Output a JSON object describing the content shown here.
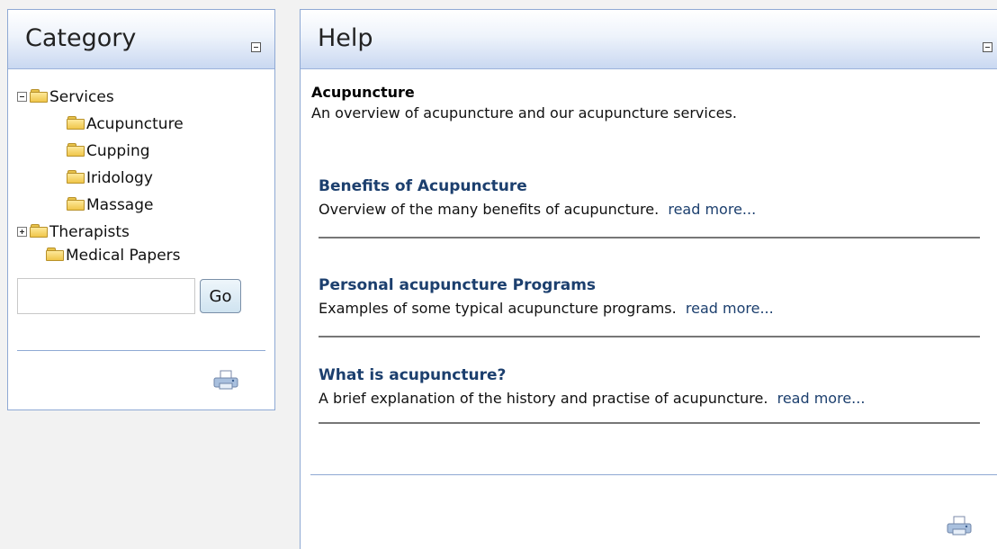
{
  "category": {
    "title": "Category",
    "tree": [
      {
        "label": "Services",
        "expander": "minus",
        "level": 0
      },
      {
        "label": "Acupuncture",
        "expander": "none",
        "level": 1
      },
      {
        "label": "Cupping",
        "expander": "none",
        "level": 1
      },
      {
        "label": "Iridology",
        "expander": "none",
        "level": 1
      },
      {
        "label": "Massage",
        "expander": "none",
        "level": 1
      },
      {
        "label": "Therapists",
        "expander": "plus",
        "level": 0
      },
      {
        "label": "Medical Papers",
        "expander": "none",
        "level": 0
      }
    ],
    "search": {
      "value": "",
      "placeholder": ""
    },
    "go_label": "Go",
    "icons": {
      "collapse": "collapse-icon",
      "folder": "folder-icon",
      "print": "print-icon"
    }
  },
  "help": {
    "title": "Help",
    "intro": {
      "title": "Acupuncture",
      "description": "An overview of acupuncture and our acupuncture services."
    },
    "articles": [
      {
        "title": "Benefits of Acupuncture",
        "description": "Overview of the many benefits of acupuncture.",
        "read_more": "read more..."
      },
      {
        "title": "Personal acupuncture Programs",
        "description": "Examples of some typical acupuncture programs.",
        "read_more": "read more..."
      },
      {
        "title": "What is acupuncture?",
        "description": "A brief explanation of the history and practise of acupuncture.",
        "read_more": "read more..."
      }
    ]
  },
  "colors": {
    "panel_border": "#8fa9d4",
    "header_gradient_bottom": "#c9d8f1",
    "link": "#1c3f6e",
    "folder": "#f0c64a"
  }
}
